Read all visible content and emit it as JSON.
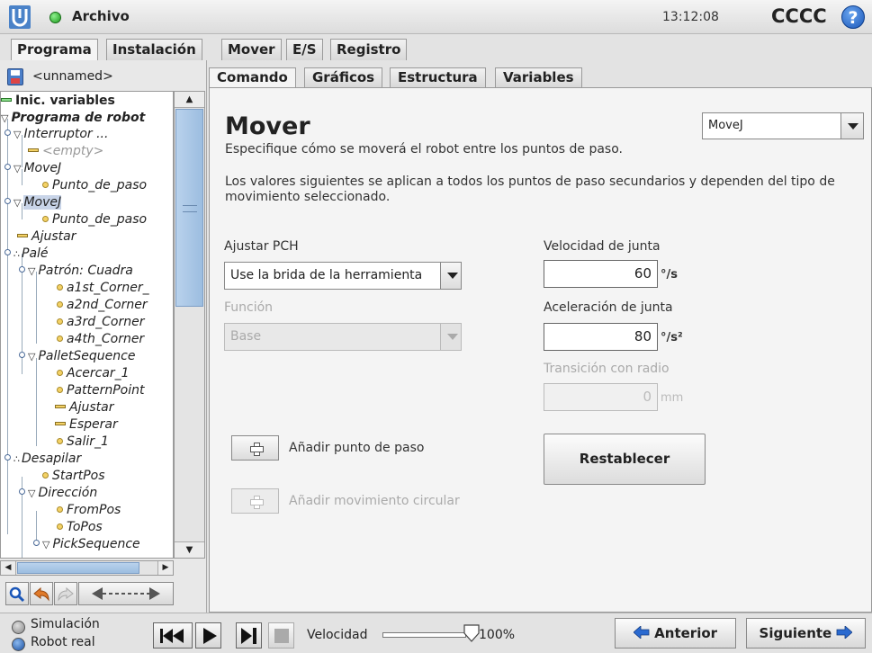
{
  "header": {
    "menu_label": "Archivo",
    "time": "13:12:08",
    "robot_name": "CCCC",
    "help_glyph": "?"
  },
  "main_tabs": [
    "Programa",
    "Instalación",
    "Mover",
    "E/S",
    "Registro"
  ],
  "left": {
    "file_name": "<unnamed>",
    "tree": [
      {
        "label": "Inic. variables",
        "icon": "dash-green"
      },
      {
        "label": "Programa de robot",
        "icon": "triangle"
      },
      {
        "label": "Interruptor ...",
        "icon": "triangle"
      },
      {
        "label": "<empty>",
        "icon": "dash"
      },
      {
        "label": "MoveJ",
        "icon": "triangle"
      },
      {
        "label": "Punto_de_paso",
        "icon": "bullet"
      },
      {
        "label": "MoveJ",
        "icon": "triangle"
      },
      {
        "label": "Punto_de_paso",
        "icon": "bullet"
      },
      {
        "label": "Ajustar",
        "icon": "dash"
      },
      {
        "label": "Palé",
        "icon": "pallet"
      },
      {
        "label": "Patrón: Cuadra",
        "icon": "triangle"
      },
      {
        "label": "a1st_Corner_",
        "icon": "bullet"
      },
      {
        "label": "a2nd_Corner",
        "icon": "bullet"
      },
      {
        "label": "a3rd_Corner",
        "icon": "bullet"
      },
      {
        "label": "a4th_Corner",
        "icon": "bullet"
      },
      {
        "label": "PalletSequence",
        "icon": "triangle"
      },
      {
        "label": "Acercar_1",
        "icon": "bullet"
      },
      {
        "label": "PatternPoint",
        "icon": "bullet"
      },
      {
        "label": "Ajustar",
        "icon": "dash"
      },
      {
        "label": "Esperar",
        "icon": "dash"
      },
      {
        "label": "Salir_1",
        "icon": "bullet"
      },
      {
        "label": "Desapilar",
        "icon": "pallet"
      },
      {
        "label": "StartPos",
        "icon": "bullet"
      },
      {
        "label": "Dirección",
        "icon": "triangle"
      },
      {
        "label": "FromPos",
        "icon": "bullet"
      },
      {
        "label": "ToPos",
        "icon": "bullet"
      },
      {
        "label": "PickSequence",
        "icon": "triangle"
      }
    ]
  },
  "content_tabs": [
    "Comando",
    "Gráficos",
    "Estructura",
    "Variables"
  ],
  "content": {
    "title": "Mover",
    "description": "Especifique cómo se moverá el robot entre los puntos de paso.",
    "note": "Los valores siguientes se aplican a todos los puntos de paso secundarios y dependen del tipo de movimiento seleccionado.",
    "move_type": "MoveJ",
    "tcp_label": "Ajustar PCH",
    "tcp_value": "Use la brida de la herramienta",
    "feature_label": "Función",
    "feature_value": "Base",
    "joint_speed_label": "Velocidad de junta",
    "joint_speed_value": "60",
    "joint_speed_unit": "°/s",
    "joint_accel_label": "Aceleración de junta",
    "joint_accel_value": "80",
    "joint_accel_unit": "°/s²",
    "blend_label": "Transición con radio",
    "blend_value": "0",
    "blend_unit": "mm",
    "add_waypoint_label": "Añadir punto de paso",
    "add_circular_label": "Añadir movimiento circular",
    "reset_label": "Restablecer"
  },
  "footer": {
    "simulation_label": "Simulación",
    "real_robot_label": "Robot real",
    "speed_label": "Velocidad",
    "speed_value": "100%",
    "speed_fraction": 1.0,
    "prev_label": "Anterior",
    "next_label": "Siguiente"
  },
  "colors": {
    "accent_blue": "#1a56b8",
    "status_green": "#1c9a1c",
    "waypoint_yellow": "#f4d266"
  }
}
